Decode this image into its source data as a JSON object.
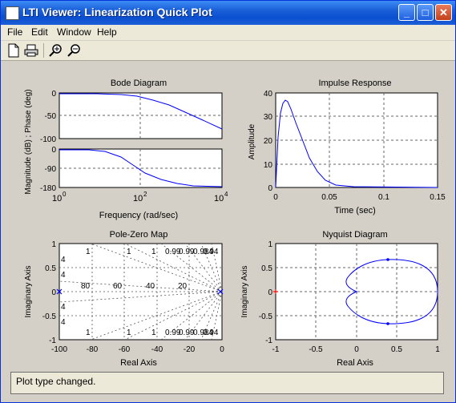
{
  "window": {
    "title": "LTI Viewer: Linearization Quick Plot"
  },
  "menu": [
    "File",
    "Edit",
    "Window",
    "Help"
  ],
  "toolbar": {
    "icons": [
      "new-file-icon",
      "print-icon",
      "zoom-in-icon",
      "zoom-out-icon"
    ]
  },
  "bode": {
    "title": "Bode Diagram",
    "ylabel": "Magnitude (dB) ; Phase (deg)",
    "xlabel": "Frequency  (rad/sec)",
    "mag_ticks": [
      "0",
      "-50",
      "-100"
    ],
    "phase_ticks": [
      "0",
      "-90",
      "-180"
    ],
    "x_tick_base": "10",
    "x_tick_exps": [
      "0",
      "2",
      "4"
    ]
  },
  "impulse": {
    "title": "Impulse Response",
    "ylabel": "Amplitude",
    "xlabel": "Time (sec)",
    "yticks": [
      "40",
      "30",
      "20",
      "10",
      "0"
    ],
    "xticks": [
      "0",
      "0.05",
      "0.1",
      "0.15"
    ]
  },
  "pzmap": {
    "title": "Pole-Zero Map",
    "ylabel": "Imaginary Axis",
    "xlabel": "Real Axis",
    "yticks": [
      "1",
      "0.5",
      "0",
      "-0.5",
      "-1"
    ],
    "xticks": [
      "-100",
      "-80",
      "-60",
      "-40",
      "-20",
      "0"
    ],
    "damping_top": [
      "1",
      "1",
      "1",
      "0.99",
      "0.99",
      "0.984",
      "0.94"
    ],
    "damping_bottom": [
      "1",
      "1",
      "1",
      "0.99",
      "0.99",
      "0.984",
      "0.94"
    ],
    "left_labels": [
      "4",
      "4",
      "4",
      "4"
    ],
    "freq_labels": [
      "80",
      "60",
      "40",
      "20"
    ]
  },
  "nyquist": {
    "title": "Nyquist Diagram",
    "ylabel": "Imaginary Axis",
    "xlabel": "Real Axis",
    "yticks": [
      "1",
      "0.5",
      "0",
      "-0.5",
      "-1"
    ],
    "xticks": [
      "-1",
      "-0.5",
      "0",
      "0.5",
      "1"
    ]
  },
  "chart_data": [
    {
      "type": "line",
      "title": "Bode Diagram",
      "xscale": "log",
      "xlim": [
        1,
        10000
      ],
      "series": [
        {
          "x": [
            1,
            100,
            1000,
            10000
          ],
          "values": [
            0,
            -3,
            -35,
            -80
          ]
        },
        {
          "x": [
            1,
            10,
            100,
            1000,
            10000
          ],
          "values": [
            0,
            -15,
            -90,
            -170,
            -180
          ]
        }
      ]
    },
    {
      "type": "line",
      "title": "Impulse Response",
      "xlim": [
        0,
        0.15
      ],
      "ylim": [
        0,
        40
      ],
      "x": [
        0,
        0.004,
        0.008,
        0.01,
        0.015,
        0.02,
        0.03,
        0.04,
        0.05,
        0.06,
        0.08,
        0.15
      ],
      "values": [
        0,
        25,
        35,
        37,
        33,
        26,
        14,
        6,
        2.5,
        1,
        0.2,
        0
      ]
    },
    {
      "type": "scatter",
      "title": "Pole-Zero Map",
      "xlim": [
        -100,
        0
      ],
      "ylim": [
        -1,
        1
      ],
      "points": [
        {
          "x": -100,
          "y": 0
        },
        {
          "x": 0,
          "y": 0
        }
      ]
    },
    {
      "type": "line",
      "title": "Nyquist Diagram",
      "xlim": [
        -1,
        1
      ],
      "ylim": [
        -1,
        1
      ],
      "x": [
        1,
        0.75,
        0.4,
        0.1,
        -0.08,
        -0.12,
        0,
        -0.12,
        -0.08,
        0.1,
        0.4,
        0.75,
        1
      ],
      "values": [
        0,
        0.5,
        0.67,
        0.6,
        0.35,
        0.12,
        0,
        -0.12,
        -0.35,
        -0.6,
        -0.67,
        -0.5,
        0
      ]
    }
  ],
  "status": "Plot type changed."
}
